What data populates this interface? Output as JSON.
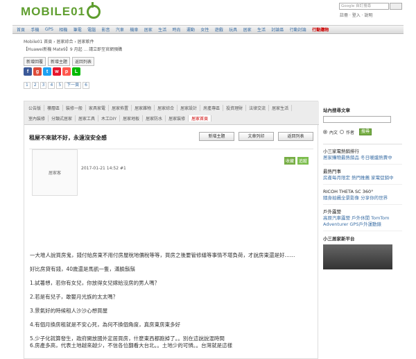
{
  "header": {
    "logo_text": "MOBILE01",
    "search_placeholder": "Google 自訂搜尋",
    "top_links": "註冊 · 登入 · 說明"
  },
  "nav": {
    "items": [
      "首頁",
      "手機",
      "GPS",
      "相機",
      "筆電",
      "電腦",
      "影音",
      "汽車",
      "機車",
      "居家",
      "生活",
      "時尚",
      "運動",
      "女性",
      "遊戲",
      "玩具",
      "居家",
      "生活",
      "討論區",
      "行動討論"
    ],
    "hot_label": "行動購物"
  },
  "breadcrumb": "Mobile01 首頁 › 居家綜合 › 居家軟件",
  "alert": "【Huawei新機 Mate9】9 月起 ... 請立即至官網預購",
  "buttons": {
    "new_post": "新增回覆",
    "reply": "新增主題",
    "back_list": "返回列表"
  },
  "share_icons": [
    "facebook-icon",
    "google-plus-icon",
    "twitter-icon",
    "weibo-icon",
    "plurk-icon",
    "line-icon"
  ],
  "pager": {
    "pages": [
      "1",
      "2",
      "3",
      "4",
      "5"
    ],
    "next_label": "下一頁",
    "last_page": "6"
  },
  "forum_tabs": {
    "row1": [
      "公告版",
      "樓層區",
      "裝修一般",
      "家具家電",
      "居家佈置",
      "居家雜物",
      "居家綜合",
      "居家設計",
      "房產專區",
      "投資理財",
      "法律交流",
      "居家生活"
    ],
    "row2": [
      "室內裝修",
      "分類式居家",
      "居家工具",
      "木工DIY",
      "居家地板",
      "居家防水",
      "居家裝修",
      "居家首頁"
    ],
    "active_label": "居家首頁"
  },
  "thread": {
    "title": "租屋不來就不好，永遠沒安全感",
    "actions": [
      "新增主題",
      "文章列印",
      "返回列表"
    ]
  },
  "post": {
    "avatar_label": "居家客",
    "meta": "2017-01-21 14:52  #1",
    "tags": [
      "收藏",
      "追蹤"
    ],
    "paragraphs": [
      "一大堆人說買房鬼，錢付給房東不用付房屋稅地價稅等等，買房之後要管修繕等事情不堪負荷，才說房東還是好……",
      "好比房貸有錢，40歲還是馬凱一隻，滿臉鬍鬚",
      "1.試著想，若你有女兒，你放得女兒嫁給沒房的男人嗎？",
      "2.若是有兒子，敢娶月光族的太太嗎？",
      "3.景氣好的時候租人沙沙心想買屋",
      "4.有個月換房租就是不安心死，為何不換個角度，真房東房東多好",
      "5.少子化就算發生，政府開放國外定居買房，什麼東西都跑掉了。。別在這說說混時間",
      "6.房產多高，代表土地越來越少，不信各位翻看大台北。。土地少的可憐。。台灣就是這樣"
    ]
  },
  "sidebar": {
    "search_title": "站內搜尋文章",
    "radio_options": [
      "內文",
      "作者"
    ],
    "search_btn": "搜尋",
    "news": [
      {
        "title": "小三家電熱銷排行",
        "text": "居家購物最熱銷品 冬日暖爐熱賣中"
      },
      {
        "title": "最熱門事",
        "text": "房產每月限定 熱門推薦 家電促銷中"
      },
      {
        "title": "RICOH THETA SC 360°",
        "text": "隨身拍攝全景影像 分享你的世界"
      },
      {
        "title": "戶外露營",
        "text": "高原汽車露營 戶外休閒 TomTom Adventurer GPS戶外運動錶"
      }
    ],
    "promo_label": "小三居家新平台"
  }
}
